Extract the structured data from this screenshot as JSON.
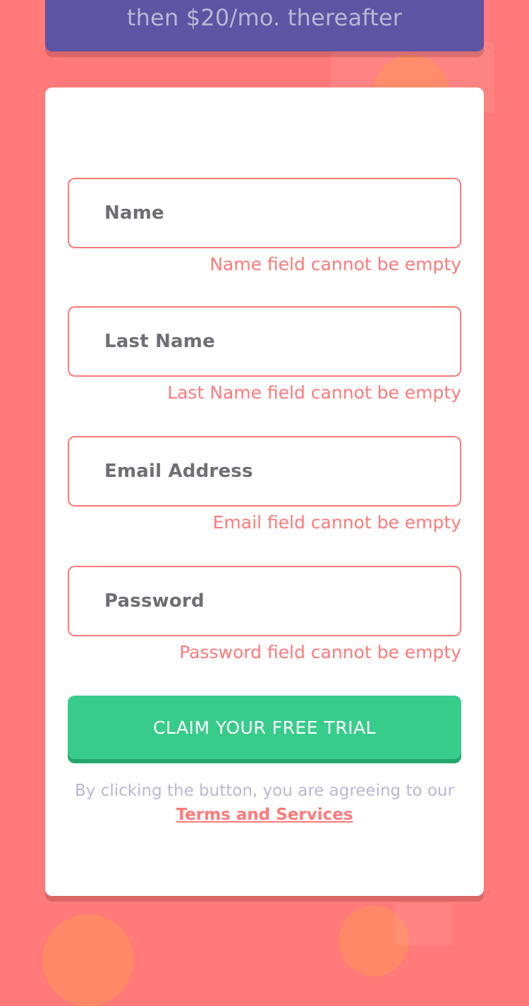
{
  "banner": {
    "text": "then $20/mo. thereafter"
  },
  "form": {
    "fields": [
      {
        "label": "Name",
        "error": "Name field cannot be empty"
      },
      {
        "label": "Last Name",
        "error": "Last Name field cannot be empty"
      },
      {
        "label": "Email Address",
        "error": "Email field cannot be empty"
      },
      {
        "label": "Password",
        "error": "Password field cannot be empty"
      }
    ],
    "submit_label": "CLAIM YOUR FREE TRIAL",
    "terms_text": "By clicking the button, you are agreeing to our",
    "terms_link": "Terms and Services"
  },
  "colors": {
    "background": "#FF7A79",
    "banner": "#5E54A4",
    "button": "#38CC8B",
    "error": "#FF7A79",
    "muted_text": "#BAB7D4"
  }
}
